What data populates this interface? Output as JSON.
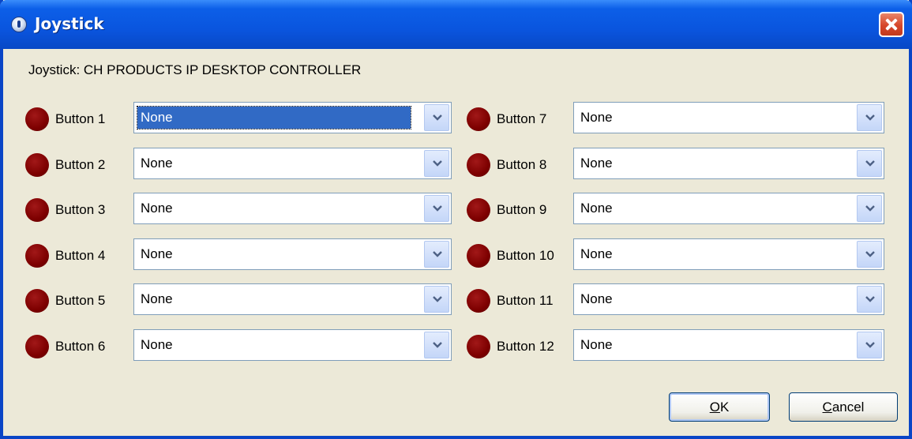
{
  "window": {
    "title": "Joystick"
  },
  "joystick_label": "Joystick: CH PRODUCTS IP DESKTOP CONTROLLER",
  "buttons": [
    {
      "label": "Button 1",
      "value": "None",
      "selected": true
    },
    {
      "label": "Button 2",
      "value": "None"
    },
    {
      "label": "Button 3",
      "value": "None"
    },
    {
      "label": "Button 4",
      "value": "None"
    },
    {
      "label": "Button 5",
      "value": "None"
    },
    {
      "label": "Button 6",
      "value": "None"
    },
    {
      "label": "Button 7",
      "value": "None"
    },
    {
      "label": "Button 8",
      "value": "None"
    },
    {
      "label": "Button 9",
      "value": "None"
    },
    {
      "label": "Button 10",
      "value": "None"
    },
    {
      "label": "Button 11",
      "value": "None"
    },
    {
      "label": "Button 12",
      "value": "None"
    }
  ],
  "actions": {
    "ok": {
      "accel": "O",
      "rest": "K"
    },
    "cancel": {
      "accel": "C",
      "rest": "ancel"
    }
  },
  "colors": {
    "indicator": "#7d0000",
    "titlebar": "#0a55de",
    "selection": "#316ac5",
    "face": "#ece9d8"
  },
  "icons": {
    "title": "joystick-app-icon",
    "close": "close-icon",
    "dropdown": "chevron-down-icon",
    "indicator": "status-led-icon"
  }
}
